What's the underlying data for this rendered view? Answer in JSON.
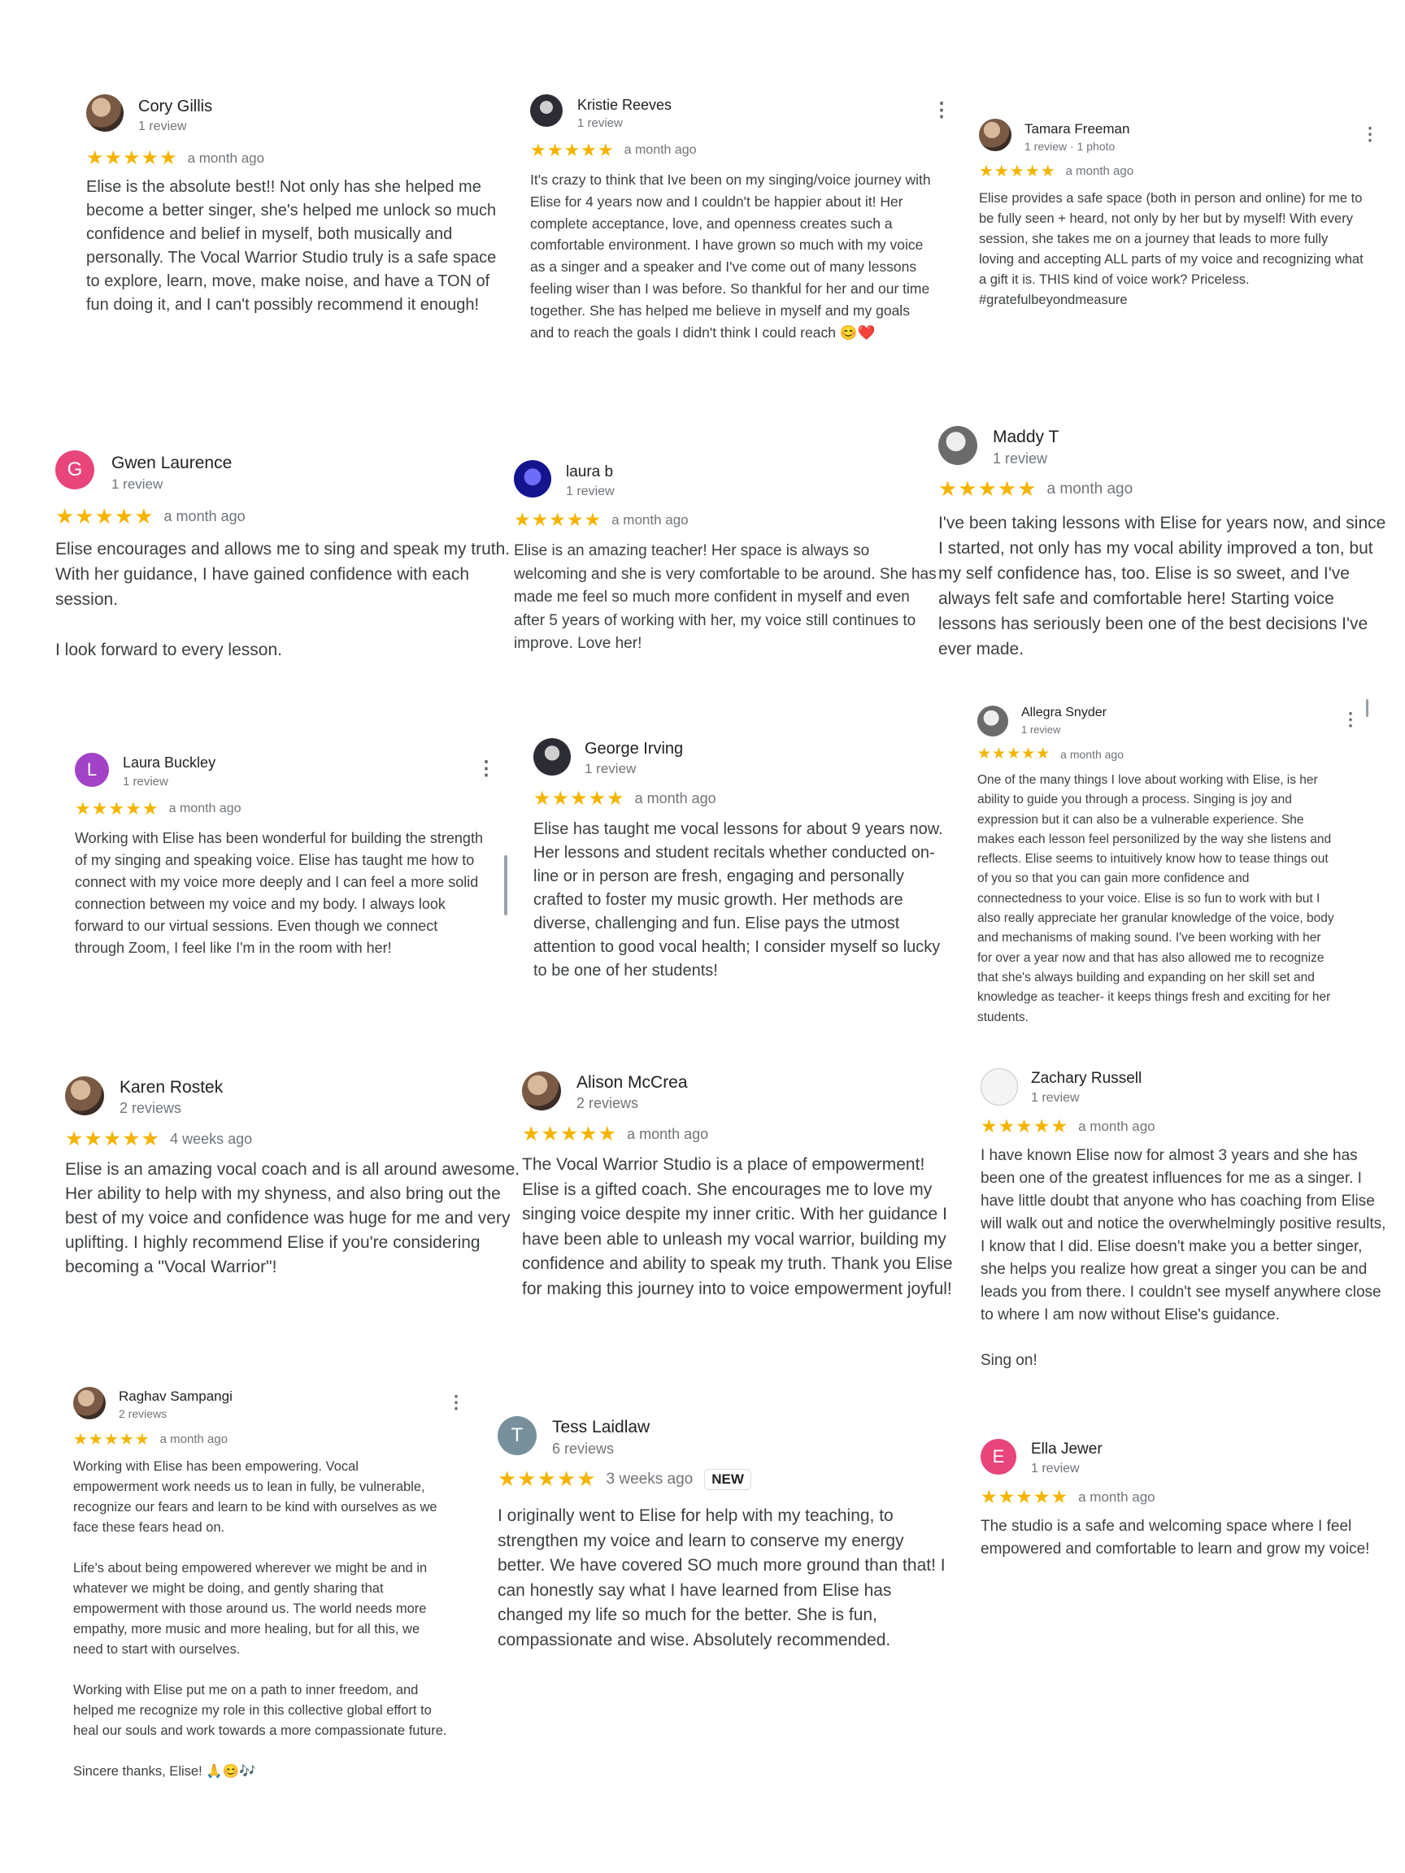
{
  "colors": {
    "star": "#f4b400",
    "text": "#3c4043",
    "muted": "#70757a"
  },
  "reviews": [
    {
      "name": "Cory Gillis",
      "sub": "1 review",
      "stars": "★★★★★",
      "ago": "a month ago",
      "avatar_icon": "profile-photo",
      "text": "Elise is the absolute best!! Not only has she helped me become a better singer, she's helped me unlock so much confidence and belief in myself, both musically and personally. The Vocal Warrior Studio truly is a safe space to explore, learn, move, make noise, and have a TON of fun doing it, and I can't possibly recommend it enough!"
    },
    {
      "name": "Kristie Reeves",
      "sub": "1 review",
      "stars": "★★★★★",
      "ago": "a month ago",
      "avatar_icon": "profile-photo",
      "menu_icon": "more-vert-icon",
      "text": "It's crazy to think that Ive been on my singing/voice journey with Elise for 4 years now and I couldn't be happier about it! Her complete acceptance, love, and openness creates such a comfortable environment. I have grown so much with my voice as a singer and a speaker and I've come out of many lessons feeling wiser than I was before. So thankful for her and our time together. She has helped me believe in myself and my goals and to reach the goals I didn't think I could reach 😊❤️"
    },
    {
      "name": "Tamara Freeman",
      "sub": "1 review · 1 photo",
      "stars": "★★★★★",
      "ago": "a month ago",
      "avatar_icon": "profile-photo",
      "menu_icon": "more-vert-icon",
      "text": "Elise provides a safe space (both in person and online) for me to be fully seen + heard, not only by her but by myself! With every session, she takes me on a journey that leads to more fully loving and accepting ALL parts of my voice and recognizing what a gift it is. THIS kind of voice work? Priceless. #gratefulbeyondmeasure"
    },
    {
      "name": "Gwen Laurence",
      "sub": "1 review",
      "stars": "★★★★★",
      "ago": "a month ago",
      "initial": "G",
      "avatar_color": "#e8457a",
      "text": "Elise encourages and allows me to sing and speak my truth.    With her guidance, I have  gained confidence with each session.\n\nI look forward to every lesson."
    },
    {
      "name": "laura b",
      "sub": "1 review",
      "stars": "★★★★★",
      "ago": "a month ago",
      "avatar_icon": "profile-photo",
      "text": "Elise is an amazing teacher! Her space is always so welcoming and she is very comfortable to be around. She has made me feel so much more confident in myself and even after 5 years of working with her, my voice still continues to improve. Love her!"
    },
    {
      "name": "Maddy T",
      "sub": "1 review",
      "stars": "★★★★★",
      "ago": "a month ago",
      "avatar_icon": "profile-photo",
      "text": "I've been taking lessons with Elise for years now, and since I started, not only has my vocal ability improved a ton, but my self confidence has, too. Elise is so sweet, and I've always felt safe and comfortable here! Starting voice lessons has seriously been one of the best decisions I've ever made."
    },
    {
      "name": "Laura Buckley",
      "sub": "1 review",
      "stars": "★★★★★",
      "ago": "a month ago",
      "initial": "L",
      "avatar_color": "#a142c7",
      "menu_icon": "more-vert-icon",
      "text": "Working with Elise has been wonderful for building the strength of my singing and speaking voice. Elise has taught me how to connect with my voice more deeply and I can feel a more solid connection between my voice and my body. I always look forward to our virtual sessions. Even though we connect through Zoom, I feel like I'm in the room with her!"
    },
    {
      "name": "George Irving",
      "sub": "1 review",
      "stars": "★★★★★",
      "ago": "a month ago",
      "avatar_icon": "profile-photo",
      "text": "Elise has taught me vocal lessons for about 9 years now.  Her lessons and student recitals whether conducted on-line or in person are fresh, engaging and personally crafted to foster my music growth.  Her methods are diverse, challenging and fun.  Elise pays the utmost attention to good vocal health; I  consider myself so lucky to be one of her students!"
    },
    {
      "name": "Allegra Snyder",
      "sub": "1 review",
      "stars": "★★★★★",
      "ago": "a month ago",
      "avatar_icon": "profile-photo",
      "menu_icon": "more-vert-icon",
      "text": "One of the many things I love about working with Elise, is her ability to guide you through a process. Singing is joy and expression but it can also be a vulnerable experience. She makes each lesson feel personilized by the way she listens and reflects. Elise seems to intuitively know how to tease things out of you so that you can gain more confidence and connectedness to your voice. Elise is so fun to work with but I also really appreciate her granular knowledge of the voice, body and mechanisms of making sound. I've been working with her for over a year now and that has also allowed me to recognize that she's always building and expanding on her skill set and knowledge as teacher- it keeps things fresh and exciting for her students."
    },
    {
      "name": "Karen Rostek",
      "sub": "2 reviews",
      "stars": "★★★★★",
      "ago": "4 weeks ago",
      "avatar_icon": "profile-photo",
      "text": "Elise is an amazing vocal coach and is all around awesome.  Her ability to help with my shyness, and also bring out the best of my voice and confidence was huge for me and very uplifting. I highly recommend Elise if you're considering becoming a \"Vocal Warrior\"!"
    },
    {
      "name": "Alison McCrea",
      "sub": "2 reviews",
      "stars": "★★★★★",
      "ago": "a month ago",
      "avatar_icon": "profile-photo",
      "text": "The Vocal Warrior Studio is a place of empowerment! Elise is a gifted coach.  She encourages me to love my singing voice despite my inner critic.  With her guidance I have been able to unleash my vocal warrior, building my confidence and ability to speak my truth. Thank you Elise for making this journey into to voice empowerment joyful!"
    },
    {
      "name": "Zachary Russell",
      "sub": "1 review",
      "stars": "★★★★★",
      "ago": "a month ago",
      "avatar_icon": "profile-sketch",
      "text": "I have known Elise now for almost 3 years and she has been one of the greatest influences for me as a singer. I have little doubt that anyone who has coaching from Elise will walk out and notice the overwhelmingly positive results, I know that I did. Elise doesn't make you a better singer, she helps you realize how great a singer you can be and leads you from there. I couldn't see myself anywhere close to where I am now without Elise's guidance.\n\nSing on!"
    },
    {
      "name": "Raghav Sampangi",
      "sub": "2 reviews",
      "stars": "★★★★★",
      "ago": "a month ago",
      "avatar_icon": "profile-photo",
      "menu_icon": "more-vert-icon",
      "text": "Working with Elise has been empowering. Vocal empowerment work needs us to lean in fully, be vulnerable, recognize our fears and learn to be kind with ourselves as we face these fears head on.\n\nLife's about being empowered wherever we might be and in whatever we might be doing, and gently sharing that empowerment with those around us. The world needs more empathy, more music and more healing, but for all this, we need to start with ourselves.\n\nWorking with Elise put me on a path to inner freedom, and helped me recognize my role in this collective global effort to heal our souls and work towards a more compassionate future.\n\nSincere thanks, Elise! 🙏😊🎶"
    },
    {
      "name": "Tess Laidlaw",
      "sub": "6 reviews",
      "stars": "★★★★★",
      "ago": "3 weeks ago",
      "badge": "NEW",
      "initial": "T",
      "avatar_color": "#78909c",
      "text": "I originally went to Elise for help with my teaching, to strengthen my voice and learn to conserve my energy better. We have covered SO much more ground than that! I can honestly say what I have learned from Elise has changed my life so much for the better. She is fun, compassionate and wise. Absolutely recommended."
    },
    {
      "name": "Ella Jewer",
      "sub": "1 review",
      "stars": "★★★★★",
      "ago": "a month ago",
      "initial": "E",
      "avatar_color": "#e8457a",
      "text": "The studio is a safe and welcoming space where I feel empowered and comfortable to learn and grow my voice!"
    }
  ]
}
